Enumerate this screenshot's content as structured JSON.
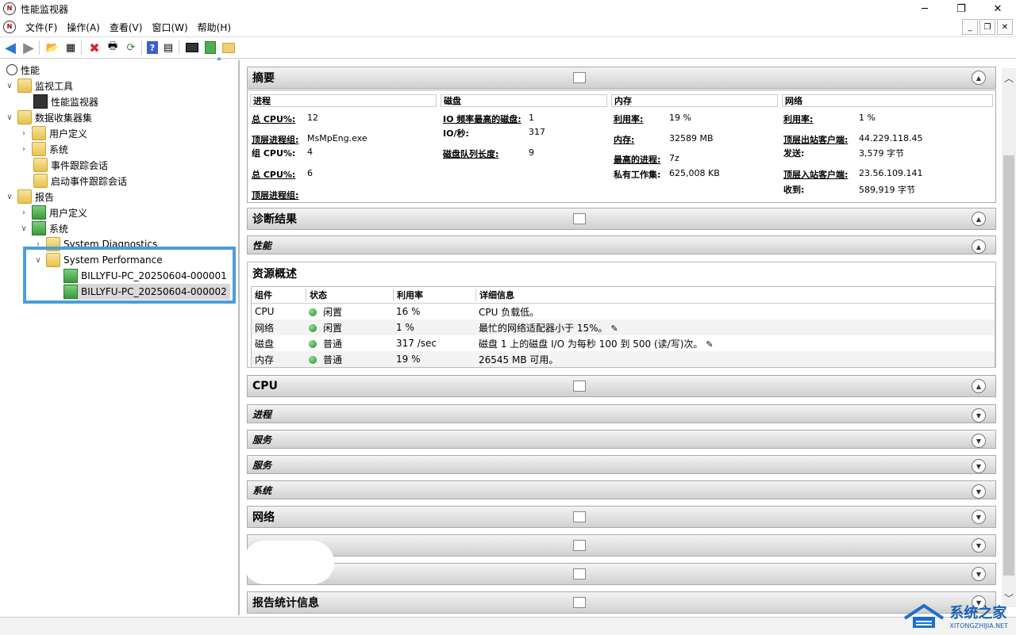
{
  "window": {
    "title": "性能监视器",
    "app_icon": "N"
  },
  "menu": [
    "文件(F)",
    "操作(A)",
    "查看(V)",
    "窗口(W)",
    "帮助(H)"
  ],
  "tree": {
    "root": "性能",
    "monitor_tools": "监视工具",
    "perf_monitor": "性能监视器",
    "collector_sets": "数据收集器集",
    "user_defined": "用户定义",
    "system": "系统",
    "event_trace": "事件跟踪会话",
    "startup_event_trace": "启动事件跟踪会话",
    "reports": "报告",
    "rep_user_defined": "用户定义",
    "rep_system": "系统",
    "sys_diag": "System Diagnostics",
    "sys_perf": "System Performance",
    "report1": "BILLYFU-PC_20250604-000001",
    "report2": "BILLYFU-PC_20250604-000002"
  },
  "summary": {
    "title": "摘要",
    "col_process": "进程",
    "col_disk": "磁盘",
    "col_memory": "内存",
    "col_network": "网络",
    "p_total_cpu_k": "总 CPU%:",
    "p_total_cpu_v": "12",
    "p_top_group_k": "顶层进程组:",
    "p_top_group_v": "MsMpEng.exe",
    "p_group_cpu_k": "组 CPU%:",
    "p_group_cpu_v": "4",
    "p_total_cpu2_k": "总 CPU%:",
    "p_total_cpu2_v": "6",
    "p_top_group2_k": "顶层进程组:",
    "d_hot_disk_k": "IO 频率最高的磁盘:",
    "d_hot_disk_v": "1",
    "d_io_k": "IO/秒:",
    "d_io_v": "317",
    "d_queue_k": "磁盘队列长度:",
    "d_queue_v": "9",
    "m_util_k": "利用率:",
    "m_util_v": "19 %",
    "m_mem_k": "内存:",
    "m_mem_v": "32589 MB",
    "m_top_proc_k": "最高的进程:",
    "m_top_proc_v": "7z",
    "m_private_k": "私有工作集:",
    "m_private_v": "625,008 KB",
    "n_util_k": "利用率:",
    "n_util_v": "1 %",
    "n_out_k": "顶层出站客户端:",
    "n_out_v": "44.229.118.45",
    "n_send_k": "发送:",
    "n_send_v": "3,579 字节",
    "n_in_k": "顶层入站客户端:",
    "n_in_v": "23.56.109.141",
    "n_recv_k": "收到:",
    "n_recv_v": "589,919 字节"
  },
  "diag": {
    "title": "诊断结果",
    "perf": "性能"
  },
  "resource": {
    "title": "资源概述",
    "headers": [
      "组件",
      "状态",
      "利用率",
      "详细信息"
    ],
    "rows": [
      {
        "comp": "CPU",
        "status": "闲置",
        "util": "16 %",
        "detail": "CPU 负载低。"
      },
      {
        "comp": "网络",
        "status": "闲置",
        "util": "1 %",
        "detail": "最忙的网络适配器小于 15%。"
      },
      {
        "comp": "磁盘",
        "status": "普通",
        "util": "317 /sec",
        "detail": "磁盘 1 上的磁盘 I/O 为每秒 100 到 500 (读/写)次。"
      },
      {
        "comp": "内存",
        "status": "普通",
        "util": "19 %",
        "detail": "26545 MB 可用。"
      }
    ]
  },
  "sections": {
    "cpu": "CPU",
    "process": "进程",
    "service1": "服务",
    "service2": "服务",
    "system": "系统",
    "network": "网络",
    "report_stats": "报告统计信息"
  },
  "watermark": {
    "t1": "系统之家",
    "t2": "XITONGZHIJIA.NET"
  }
}
